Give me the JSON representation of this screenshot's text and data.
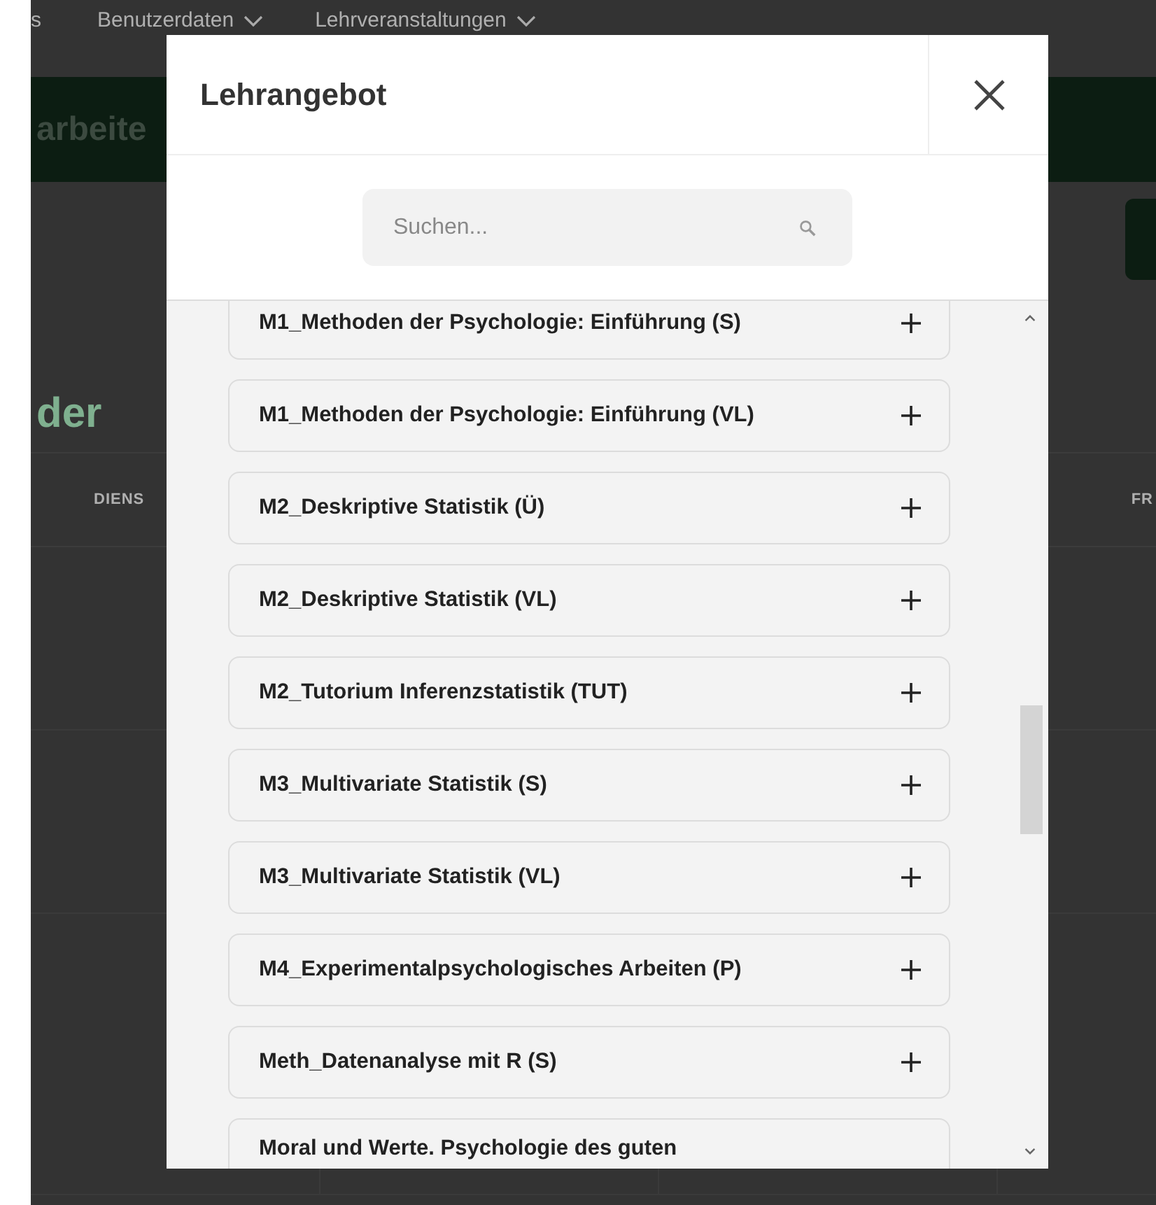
{
  "background": {
    "nav": [
      {
        "label": "s",
        "dropdown": false
      },
      {
        "label": "Benutzerdaten",
        "dropdown": true
      },
      {
        "label": "Lehrveranstaltungen",
        "dropdown": true
      }
    ],
    "banner": "arbeite",
    "heading": "der",
    "table_header": [
      "DIENS",
      "FR"
    ]
  },
  "modal": {
    "title": "Lehrangebot",
    "search": {
      "placeholder": "Suchen..."
    },
    "courses": [
      {
        "label": "M1_Methoden der Psychologie: Einführung (S)"
      },
      {
        "label": "M1_Methoden der Psychologie: Einführung (VL)"
      },
      {
        "label": "M2_Deskriptive Statistik (Ü)"
      },
      {
        "label": "M2_Deskriptive Statistik (VL)"
      },
      {
        "label": "M2_Tutorium Inferenzstatistik (TUT)"
      },
      {
        "label": "M3_Multivariate Statistik (S)"
      },
      {
        "label": "M3_Multivariate Statistik (VL)"
      },
      {
        "label": "M4_Experimentalpsychologisches Arbeiten (P)"
      },
      {
        "label": "Meth_Datenanalyse mit R (S)"
      },
      {
        "label": "Moral und Werte. Psychologie des guten"
      }
    ]
  }
}
